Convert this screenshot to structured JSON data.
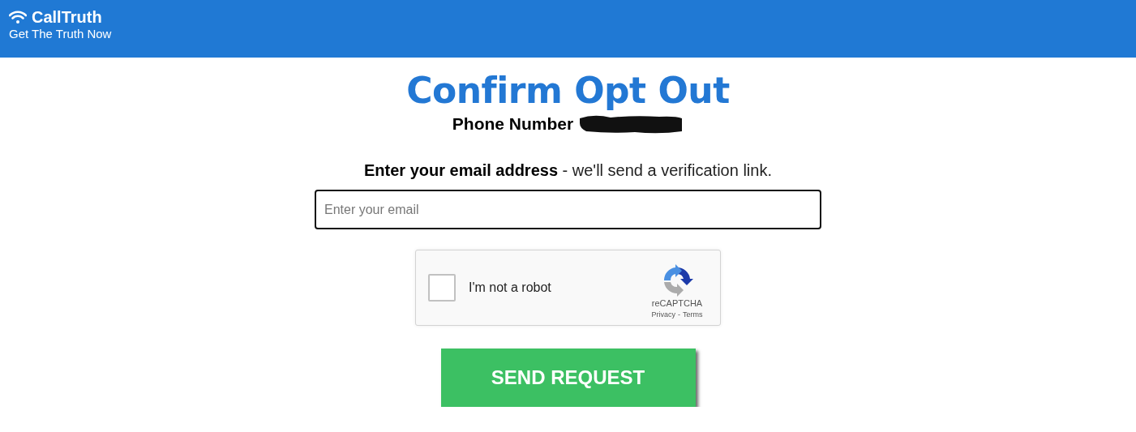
{
  "header": {
    "brand": "CallTruth",
    "tagline": "Get The Truth Now"
  },
  "title": "Confirm Opt Out",
  "phone": {
    "label": "Phone Number",
    "redacted": true
  },
  "instruction": "**Enter your email address** - we'll send a verification link.",
  "email_field": {
    "placeholder": "Enter your email"
  },
  "captcha": {
    "label": "I'm not a robot",
    "checked": false,
    "brand": "reCAPTCHA",
    "links": [
      "Privacy",
      "Terms"
    ],
    "separator": "-"
  },
  "submit_button": "SEND REQUEST"
}
